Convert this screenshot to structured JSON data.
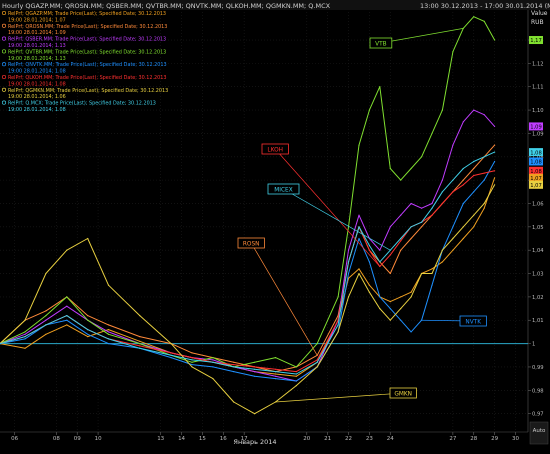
{
  "header": {
    "title": "Hourly QGAZP.MM; QROSN.MM; QSBER.MM; QVTBR.MM; QNVTK.MM; QLKOH.MM; QGMKN.MM; Q.MCX",
    "range": "13:00 30.12.2013 - 17:00 30.01.2014 (MOW)"
  },
  "legend": [
    {
      "line1": "RelPrf; QGAZP.MM; Trade Price(Last); Specified Date; 30.12.2013",
      "line2": "19:00 28.01.2014; 1.07",
      "color": "#f0a020"
    },
    {
      "line1": "RelPrf; QROSN.MM; Trade Price(Last); Specified Date; 30.12.2013",
      "line2": "19:00 28.01.2014; 1.09",
      "color": "#ff8a3a"
    },
    {
      "line1": "RelPrf; QSBER.MM; Trade Price(Last); Specified Date; 30.12.2013",
      "line2": "19:00 28.01.2014; 1.13",
      "color": "#c03cff"
    },
    {
      "line1": "RelPrf; QVTBR.MM; Trade Price(Last); Specified Date; 30.12.2013",
      "line2": "19:00 28.01.2014; 1.13",
      "color": "#80e030"
    },
    {
      "line1": "RelPrf; QNVTK.MM; Trade Price(Last); Specified Date; 30.12.2013",
      "line2": "19:00 28.01.2014; 1.08",
      "color": "#1e90ff"
    },
    {
      "line1": "RelPrf; QLKOH.MM; Trade Price(Last); Specified Date; 30.12.2013",
      "line2": "19:00 28.01.2014; 1.08",
      "color": "#ff3030"
    },
    {
      "line1": "RelPrf; QGMKN.MM; Trade Price(Last); Specified Date; 30.12.2013",
      "line2": "19:00 28.01.2014; 1.06",
      "color": "#e8d040"
    },
    {
      "line1": "RelPrf; Q.MCX; Trade Price(Last); Specified Date; 30.12.2013",
      "line2": "19:00 28.01.2014; 1.08",
      "color": "#40d0e8"
    }
  ],
  "axis": {
    "value_label": "Value",
    "unit_label": "RUB",
    "xlabel": "Январь 2014",
    "auto_label": "Auto"
  },
  "annotations": [
    {
      "text": "VTB",
      "color": "#80e030",
      "series": 3
    },
    {
      "text": "LKOH",
      "color": "#ff3030",
      "series": 5
    },
    {
      "text": "MICEX",
      "color": "#40d0e8",
      "series": 7
    },
    {
      "text": "ROSN",
      "color": "#ff8a3a",
      "series": 1
    },
    {
      "text": "NVTK",
      "color": "#1e90ff",
      "series": 4
    },
    {
      "text": "GMKN",
      "color": "#e8d040",
      "series": 6
    }
  ],
  "chart_data": {
    "type": "line",
    "xlabel": "Январь 2014",
    "ylabel": "RUB",
    "xlim": [
      5.3,
      30.6
    ],
    "ylim": [
      0.963,
      1.142
    ],
    "x_ticks": [
      6,
      8,
      9,
      10,
      13,
      14,
      15,
      16,
      17,
      20,
      21,
      22,
      23,
      24,
      27,
      28,
      29,
      30
    ],
    "y_ticks": [
      0.97,
      0.98,
      0.99,
      1,
      1.01,
      1.02,
      1.03,
      1.04,
      1.05,
      1.06,
      1.07,
      1.08,
      1.09,
      1.1,
      1.11,
      1.12,
      1.13
    ],
    "baseline": 1.0,
    "end_labels": [
      {
        "text": "1,17",
        "value": 1.13,
        "color": "#80e030"
      },
      {
        "text": "1,09",
        "value": 1.093,
        "color": "#c03cff"
      },
      {
        "text": "1,08",
        "value": 1.082,
        "color": "#40d0e8"
      },
      {
        "text": "1,08",
        "value": 1.078,
        "color": "#1e90ff"
      },
      {
        "text": "1,08",
        "value": 1.074,
        "color": "#ff3030"
      },
      {
        "text": "1,07",
        "value": 1.071,
        "color": "#f0a020"
      },
      {
        "text": "1,07",
        "value": 1.068,
        "color": "#e8d040"
      }
    ],
    "x": [
      5.3,
      6.5,
      7.5,
      8.5,
      9.5,
      10.5,
      12,
      13.5,
      14.5,
      15.5,
      16.5,
      17.5,
      18.5,
      19.5,
      20.5,
      21.5,
      22,
      22.5,
      23,
      23.5,
      24,
      24.5,
      25,
      25.5,
      26,
      26.5,
      27,
      27.5,
      28,
      28.5,
      29
    ],
    "series": [
      {
        "name": "QGAZP.MM",
        "color": "#f0a020",
        "values": [
          1.0,
          0.998,
          1.004,
          1.008,
          1.003,
          1.006,
          1.001,
          0.996,
          0.994,
          0.992,
          0.99,
          0.988,
          0.987,
          0.986,
          0.992,
          1.01,
          1.028,
          1.032,
          1.025,
          1.02,
          1.018,
          1.02,
          1.022,
          1.03,
          1.032,
          1.035,
          1.04,
          1.045,
          1.05,
          1.058,
          1.071
        ]
      },
      {
        "name": "QROSN.MM",
        "color": "#ff8a3a",
        "values": [
          1.0,
          1.01,
          1.014,
          1.02,
          1.012,
          1.008,
          1.003,
          1.0,
          0.996,
          0.994,
          0.992,
          0.99,
          0.988,
          0.99,
          0.995,
          1.012,
          1.035,
          1.05,
          1.04,
          1.035,
          1.03,
          1.04,
          1.045,
          1.05,
          1.055,
          1.06,
          1.065,
          1.07,
          1.075,
          1.08,
          1.085
        ]
      },
      {
        "name": "QSBER.MM",
        "color": "#c03cff",
        "values": [
          1.0,
          1.004,
          1.01,
          1.016,
          1.01,
          1.005,
          1.0,
          0.996,
          0.994,
          0.993,
          0.99,
          0.988,
          0.986,
          0.984,
          0.99,
          1.01,
          1.04,
          1.055,
          1.045,
          1.04,
          1.05,
          1.055,
          1.06,
          1.058,
          1.06,
          1.07,
          1.085,
          1.095,
          1.1,
          1.098,
          1.093
        ]
      },
      {
        "name": "QVTBR.MM",
        "color": "#80e030",
        "values": [
          1.0,
          1.005,
          1.012,
          1.02,
          1.01,
          1.004,
          1.0,
          0.995,
          0.992,
          0.994,
          0.99,
          0.992,
          0.994,
          0.99,
          1.0,
          1.02,
          1.05,
          1.085,
          1.1,
          1.11,
          1.075,
          1.07,
          1.075,
          1.08,
          1.09,
          1.1,
          1.125,
          1.135,
          1.14,
          1.138,
          1.13
        ]
      },
      {
        "name": "QNVTK.MM",
        "color": "#1e90ff",
        "values": [
          1.0,
          1.002,
          1.008,
          1.01,
          1.004,
          1.0,
          0.998,
          0.994,
          0.991,
          0.99,
          0.988,
          0.986,
          0.985,
          0.984,
          0.99,
          1.005,
          1.03,
          1.045,
          1.035,
          1.02,
          1.015,
          1.01,
          1.005,
          1.01,
          1.025,
          1.04,
          1.05,
          1.06,
          1.065,
          1.07,
          1.078
        ]
      },
      {
        "name": "QLKOH.MM",
        "color": "#ff3030",
        "values": [
          1.0,
          1.003,
          1.008,
          1.012,
          1.006,
          1.002,
          0.999,
          0.996,
          0.994,
          0.992,
          0.991,
          0.99,
          0.989,
          0.988,
          0.993,
          1.01,
          1.035,
          1.05,
          1.04,
          1.033,
          1.038,
          1.044,
          1.05,
          1.052,
          1.055,
          1.06,
          1.065,
          1.068,
          1.072,
          1.073,
          1.074
        ]
      },
      {
        "name": "QGMKN.MM",
        "color": "#e8d040",
        "values": [
          1.0,
          1.01,
          1.03,
          1.04,
          1.045,
          1.025,
          1.012,
          1.0,
          0.99,
          0.985,
          0.975,
          0.97,
          0.975,
          0.982,
          0.99,
          1.005,
          1.02,
          1.03,
          1.022,
          1.015,
          1.01,
          1.015,
          1.02,
          1.03,
          1.03,
          1.04,
          1.045,
          1.05,
          1.055,
          1.06,
          1.068
        ]
      },
      {
        "name": "Q.MCX",
        "color": "#40d0e8",
        "values": [
          1.0,
          1.003,
          1.008,
          1.012,
          1.006,
          1.002,
          0.998,
          0.995,
          0.993,
          0.992,
          0.99,
          0.989,
          0.988,
          0.987,
          0.992,
          1.008,
          1.035,
          1.05,
          1.042,
          1.035,
          1.04,
          1.045,
          1.05,
          1.052,
          1.058,
          1.065,
          1.07,
          1.075,
          1.078,
          1.08,
          1.082
        ]
      }
    ]
  }
}
